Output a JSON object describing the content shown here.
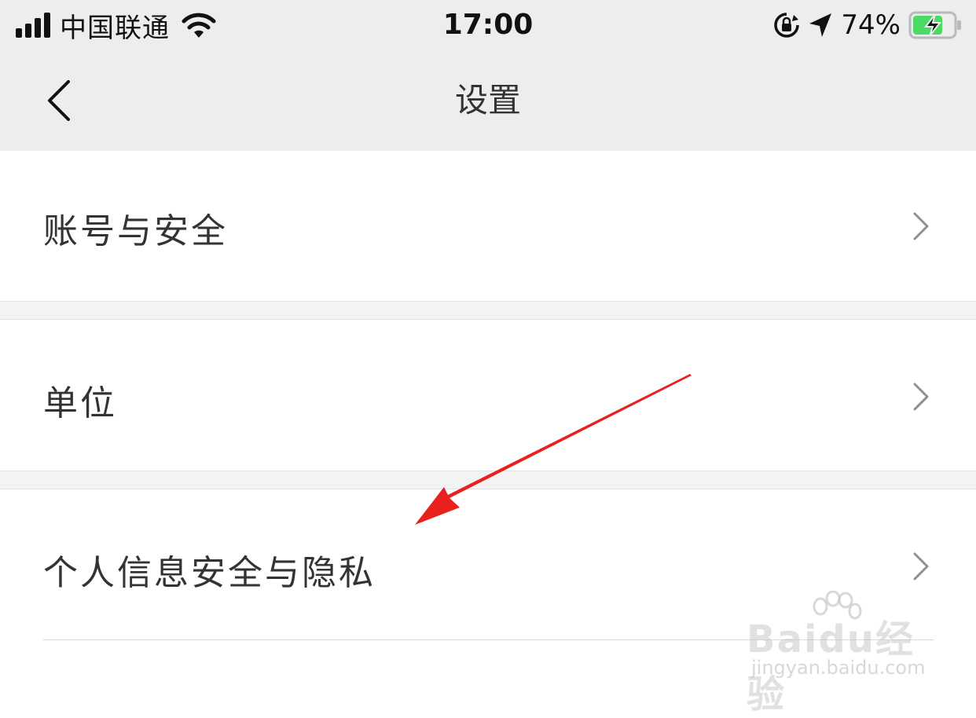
{
  "status_bar": {
    "carrier": "中国联通",
    "time": "17:00",
    "battery_percent": "74%",
    "battery_level": 0.74,
    "battery_color": "#4cd964",
    "icons": [
      "signal-icon",
      "wifi-icon",
      "rotation-lock-icon",
      "location-icon",
      "battery-icon"
    ]
  },
  "nav": {
    "title": "设置",
    "back_icon": "chevron-left-icon"
  },
  "settings": {
    "items": [
      {
        "label": "账号与安全",
        "icon": "chevron-right-icon"
      },
      {
        "label": "单位",
        "icon": "chevron-right-icon"
      },
      {
        "label": "个人信息安全与隐私",
        "icon": "chevron-right-icon"
      }
    ]
  },
  "annotation": {
    "arrow_color": "#e8201e"
  },
  "watermark": {
    "logo": "Baidu经验",
    "url": "jingyan.baidu.com"
  }
}
